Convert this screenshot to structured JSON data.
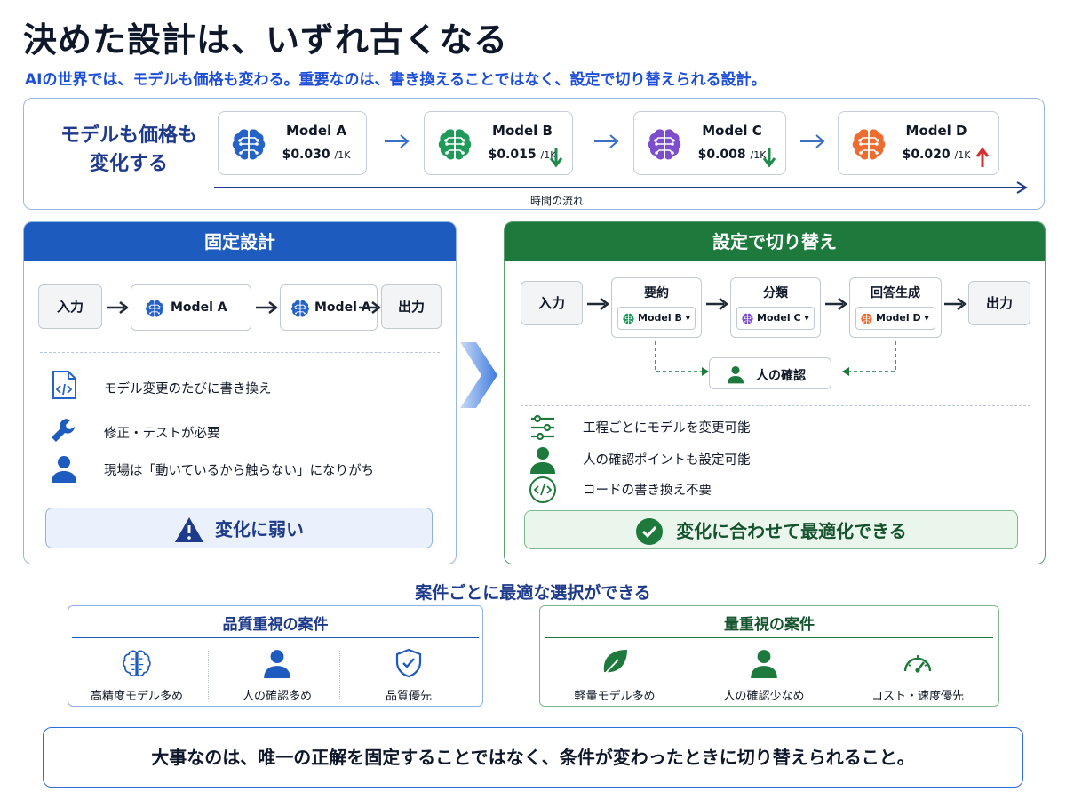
{
  "title": "決めた設計は、いずれ古くなる",
  "subtitle": "AIの世界では、モデルも価格も変わる。重要なのは、書き換えることではなく、設定で切り替えられる設計。",
  "timeline": {
    "label_line1": "モデルも価格も",
    "label_line2": "変化する",
    "axis_label": "時間の流れ",
    "models": [
      {
        "name": "Model A",
        "price": "$0.030",
        "unit": "/1K",
        "color": "#2563c9",
        "trend": "none"
      },
      {
        "name": "Model B",
        "price": "$0.015",
        "unit": "/1K",
        "color": "#1f9a5b",
        "trend": "down"
      },
      {
        "name": "Model C",
        "price": "$0.008",
        "unit": "/1K",
        "color": "#7c4dcc",
        "trend": "down"
      },
      {
        "name": "Model D",
        "price": "$0.020",
        "unit": "/1K",
        "color": "#ef6c2f",
        "trend": "up"
      }
    ]
  },
  "fixed": {
    "header": "固定設計",
    "flow": {
      "input": "入力",
      "model1": "Model A",
      "model2": "Model A",
      "output": "出力"
    },
    "features": [
      "モデル変更のたびに書き換え",
      "修正・テストが必要",
      "現場は「動いているから触らない」になりがち"
    ],
    "banner": "変化に弱い",
    "accent": "#1e5bbf"
  },
  "switch": {
    "header": "設定で切り替え",
    "flow": {
      "input": "入力",
      "output": "出力",
      "steps": [
        {
          "label": "要約",
          "model": "Model B"
        },
        {
          "label": "分類",
          "model": "Model C"
        },
        {
          "label": "回答生成",
          "model": "Model D"
        }
      ],
      "review": "人の確認"
    },
    "features": [
      "工程ごとにモデルを変更可能",
      "人の確認ポイントも設定可能",
      "コードの書き換え不要"
    ],
    "banner": "変化に合わせて最適化できる",
    "accent": "#1e7a3c"
  },
  "cases": {
    "title": "案件ごとに最適な選択ができる",
    "quality": {
      "header": "品質重視の案件",
      "items": [
        "高精度モデル多め",
        "人の確認多め",
        "品質優先"
      ]
    },
    "volume": {
      "header": "量重視の案件",
      "items": [
        "軽量モデル多め",
        "人の確認少なめ",
        "コスト・速度優先"
      ]
    }
  },
  "footer": "大事なのは、唯一の正解を固定することではなく、条件が変わったときに切り替えられること。"
}
